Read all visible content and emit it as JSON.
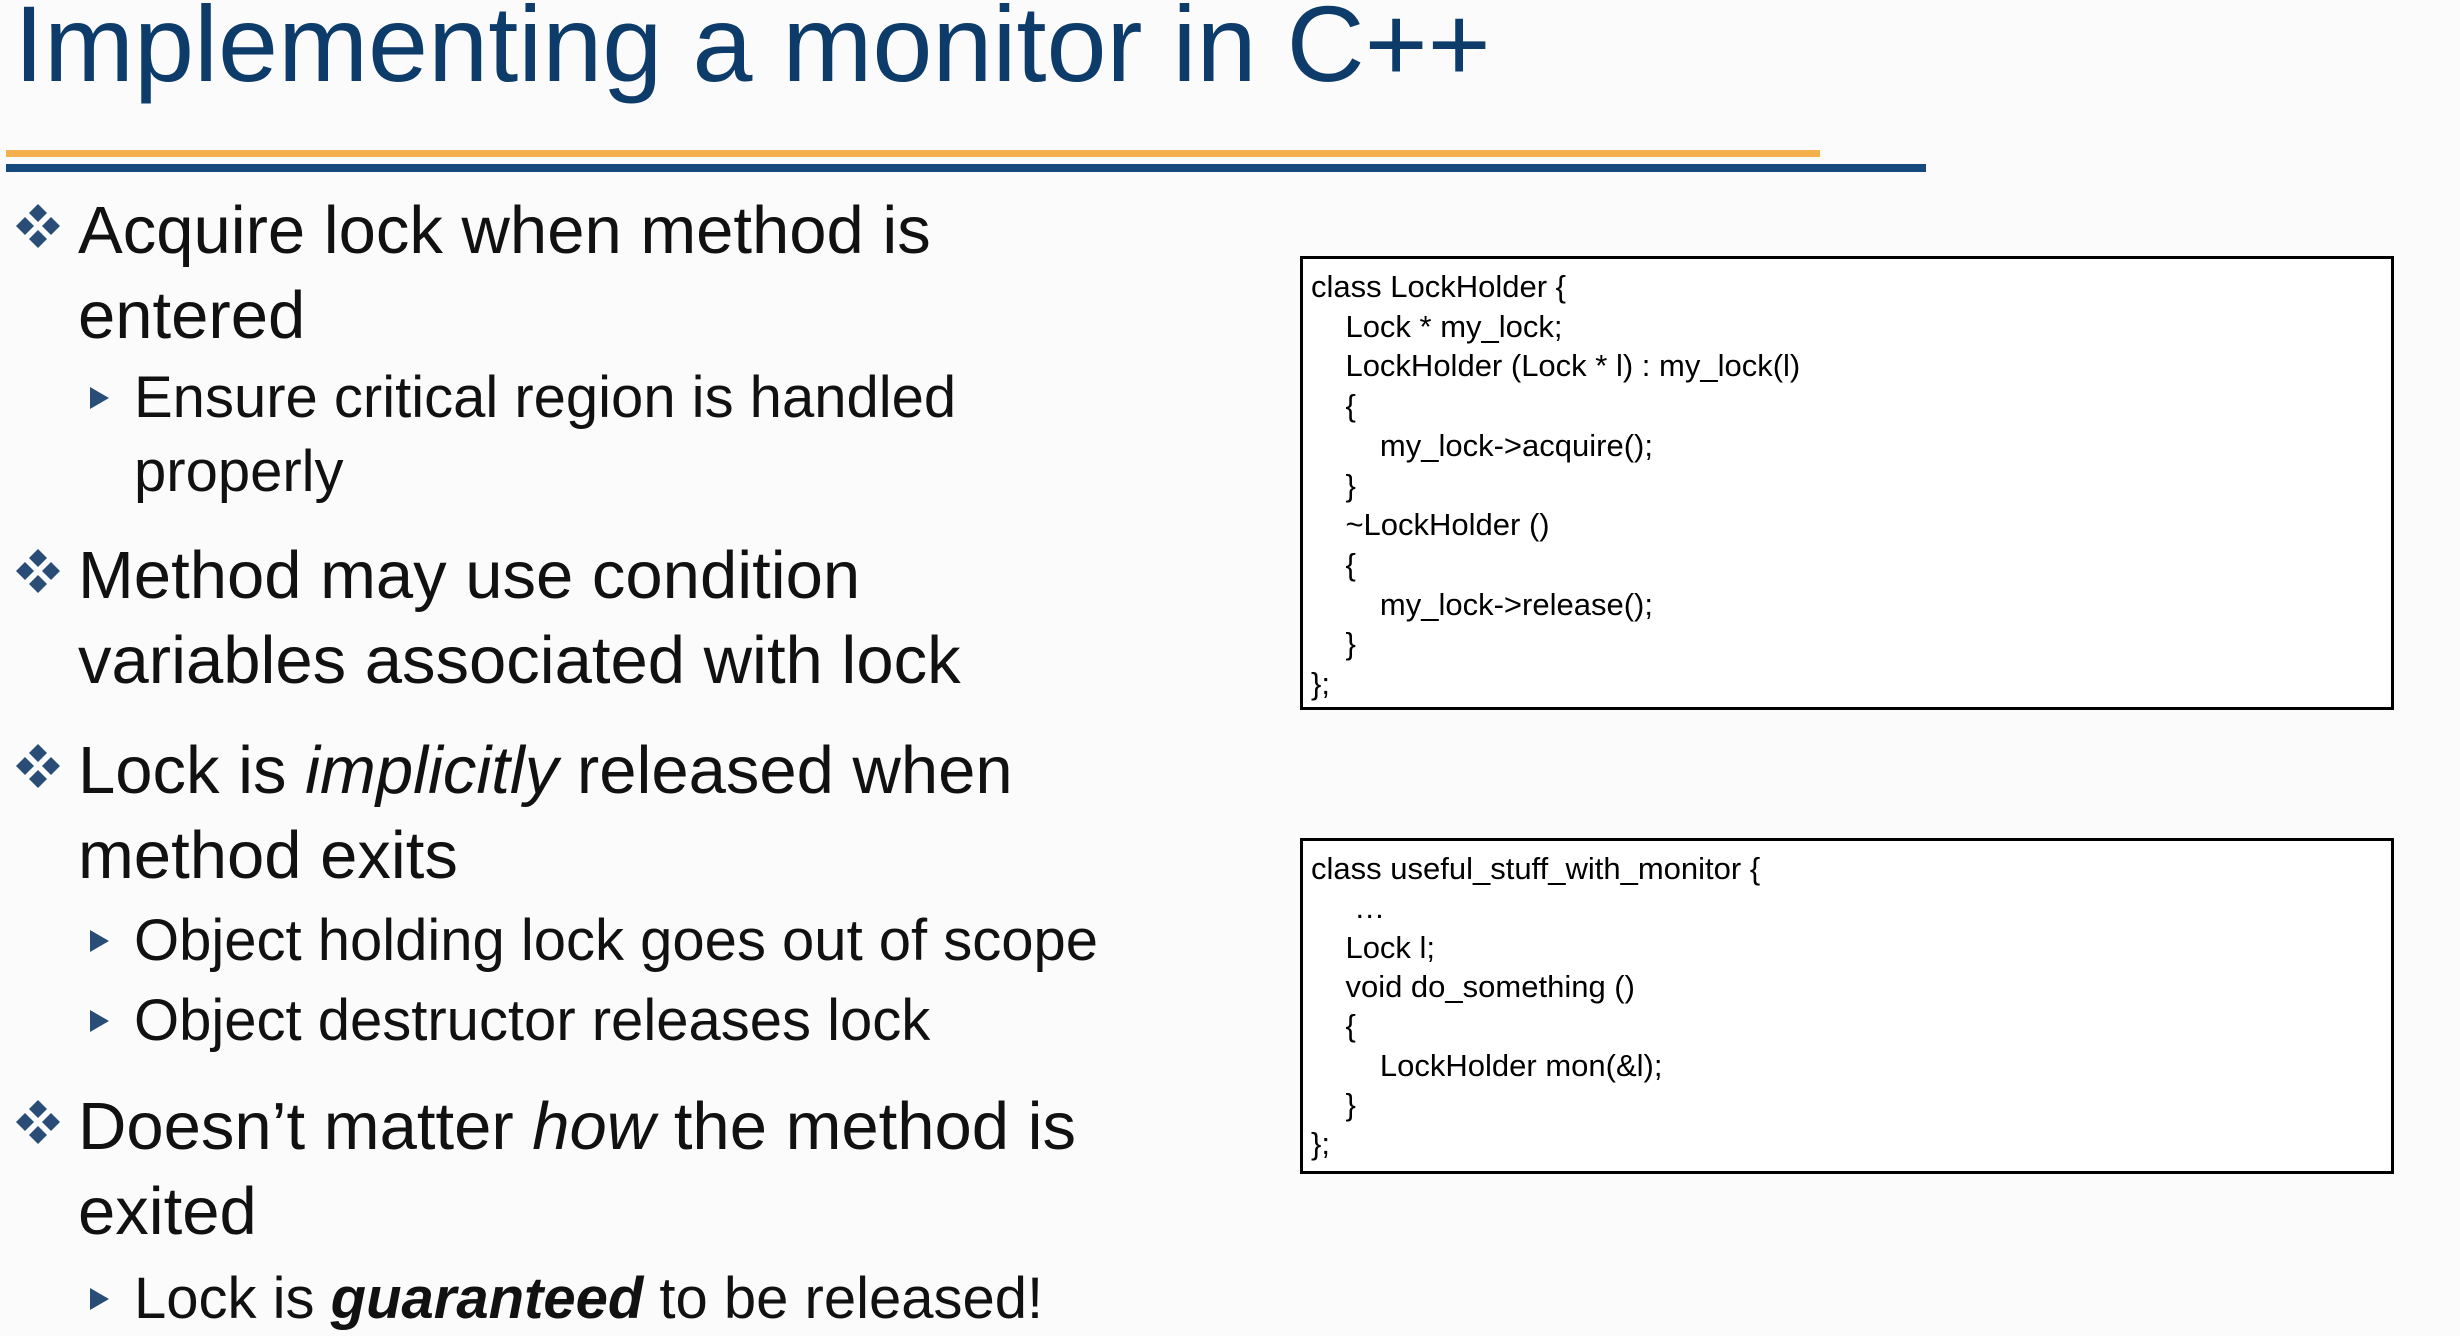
{
  "slide": {
    "title": "Implementing a monitor in C++"
  },
  "bullets": {
    "b1": {
      "line1": "Acquire lock when method is",
      "line2": "entered",
      "sub1": {
        "line1": "Ensure critical region is handled",
        "line2": "properly"
      }
    },
    "b2": {
      "line1": "Method may use condition",
      "line2": "variables associated with lock"
    },
    "b3": {
      "pre": "Lock is ",
      "em": "implicitly",
      "post": " released when",
      "line2": "method exits",
      "sub1": "Object holding lock goes out of scope",
      "sub2": "Object destructor releases lock"
    },
    "b4": {
      "pre": "Doesn’t matter ",
      "em": "how",
      "post": " the method is",
      "line2": "exited",
      "sub1": {
        "pre": "Lock is ",
        "strong": "guaranteed",
        "post": " to be released!"
      }
    }
  },
  "code": {
    "lockholder": [
      "class LockHolder {",
      "    Lock * my_lock;",
      "    LockHolder (Lock * l) : my_lock(l)",
      "    {",
      "        my_lock->acquire();",
      "    }",
      "    ~LockHolder ()",
      "    {",
      "        my_lock->release();",
      "    }",
      "};"
    ],
    "useful": [
      "class useful_stuff_with_monitor {",
      "     …",
      "    Lock l;",
      "    void do_something ()",
      "    {",
      "        LockHolder mon(&l);",
      "    }",
      "};"
    ]
  },
  "colors": {
    "title": "#0e3c6a",
    "rule_orange": "#f3b04c",
    "rule_blue": "#164a7e",
    "bullet_marker": "#2a4d78"
  },
  "icons": {
    "level1_marker": "four-diamond-bullet-icon",
    "level2_marker": "triangle-bullet-icon"
  }
}
